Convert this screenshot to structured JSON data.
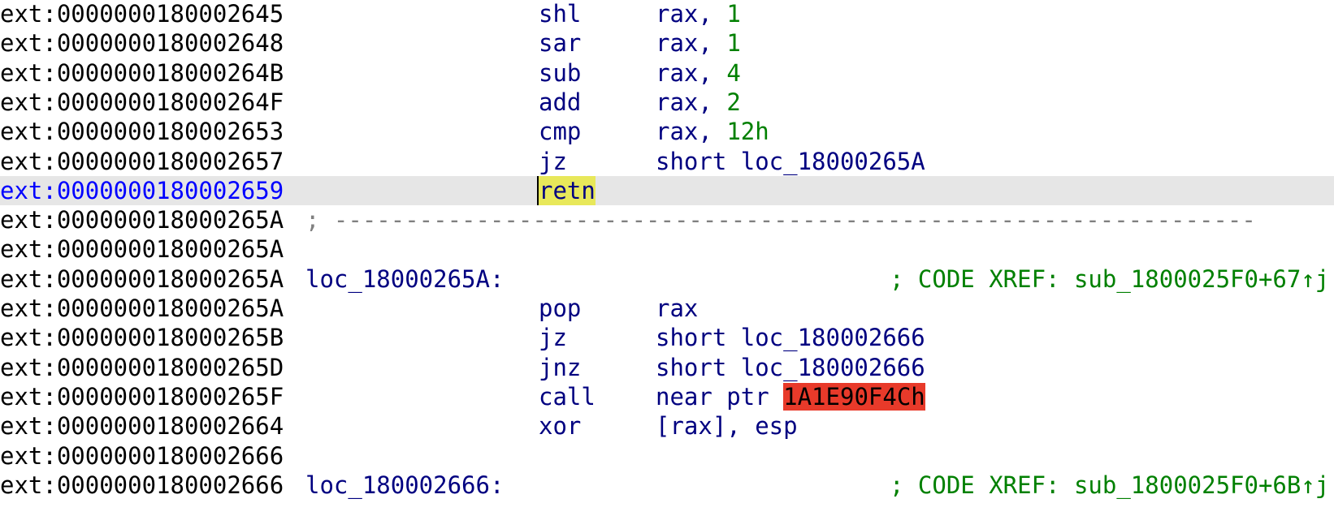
{
  "listing": {
    "rows": [
      {
        "addr": "ext:0000000180002645",
        "mnemonic": "shl",
        "operand": "rax, ",
        "number": "1"
      },
      {
        "addr": "ext:0000000180002648",
        "mnemonic": "sar",
        "operand": "rax, ",
        "number": "1"
      },
      {
        "addr": "ext:000000018000264B",
        "mnemonic": "sub",
        "operand": "rax, ",
        "number": "4"
      },
      {
        "addr": "ext:000000018000264F",
        "mnemonic": "add",
        "operand": "rax, ",
        "number": "2"
      },
      {
        "addr": "ext:0000000180002653",
        "mnemonic": "cmp",
        "operand": "rax, ",
        "number": "12h"
      },
      {
        "addr": "ext:0000000180002657",
        "mnemonic": "jz",
        "operand": "short loc_18000265A"
      },
      {
        "addr": "ext:0000000180002659",
        "mnemonic": "retn",
        "selected": true
      },
      {
        "addr": "ext:000000018000265A",
        "separator": "; -----------------------------------------------------------------"
      },
      {
        "addr": "ext:000000018000265A"
      },
      {
        "addr": "ext:000000018000265A",
        "label": "loc_18000265A:",
        "comment": "; CODE XREF: sub_1800025F0+67↑j"
      },
      {
        "addr": "ext:000000018000265A",
        "mnemonic": "pop",
        "operand": "rax"
      },
      {
        "addr": "ext:000000018000265B",
        "mnemonic": "jz",
        "operand": "short loc_180002666"
      },
      {
        "addr": "ext:000000018000265D",
        "mnemonic": "jnz",
        "operand": "short loc_180002666"
      },
      {
        "addr": "ext:000000018000265F",
        "mnemonic": "call",
        "operand": "near ptr ",
        "bad_target": "1A1E90F4Ch"
      },
      {
        "addr": "ext:0000000180002664",
        "mnemonic": "xor",
        "operand": "[rax], esp"
      },
      {
        "addr": "ext:0000000180002666"
      },
      {
        "addr": "ext:0000000180002666",
        "label": "loc_180002666:",
        "comment": "; CODE XREF: sub_1800025F0+6B↑j"
      }
    ],
    "colors": {
      "address": "#000000",
      "current_address": "#0000ff",
      "instruction": "#000080",
      "number": "#008000",
      "comment": "#008000",
      "separator": "#808080",
      "selection_bg": "#e6e6e6",
      "highlight_yellow": "#e8e85a",
      "highlight_red": "#e83a2a"
    }
  }
}
